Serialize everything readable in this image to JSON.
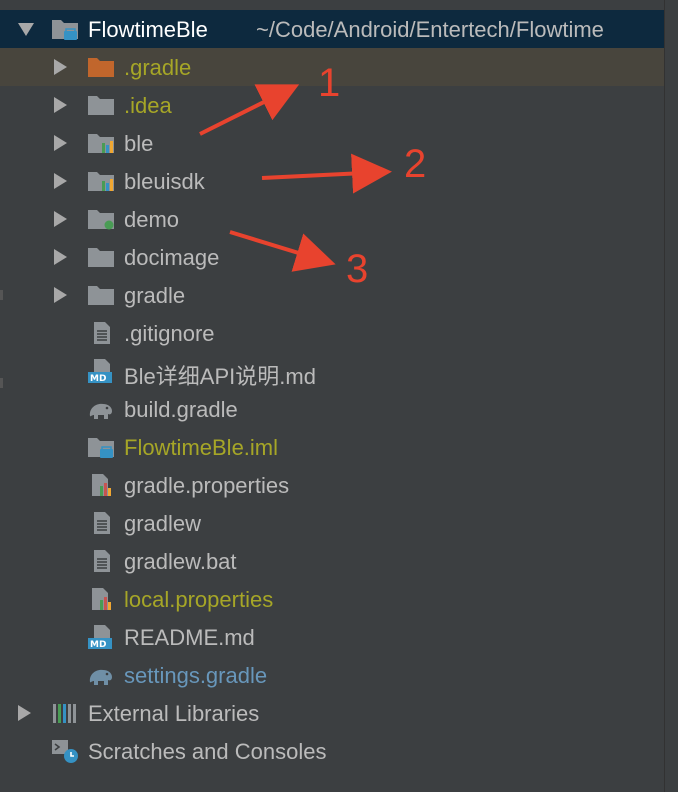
{
  "tree": {
    "root": {
      "name": "FlowtimeBle",
      "path": "~/Code/Android/Entertech/Flowtime",
      "icon": "folder-module-icon",
      "expanded": true
    },
    "items": [
      {
        "label": ".gradle",
        "icon": "folder-icon",
        "expandable": true,
        "color": "olive"
      },
      {
        "label": ".idea",
        "icon": "folder-icon",
        "expandable": true,
        "color": "olive"
      },
      {
        "label": "ble",
        "icon": "library-module-icon",
        "expandable": true,
        "color": "default"
      },
      {
        "label": "bleuisdk",
        "icon": "library-module-icon",
        "expandable": true,
        "color": "default"
      },
      {
        "label": "demo",
        "icon": "app-module-icon",
        "expandable": true,
        "color": "default"
      },
      {
        "label": "docimage",
        "icon": "folder-icon",
        "expandable": true,
        "color": "default"
      },
      {
        "label": "gradle",
        "icon": "folder-icon",
        "expandable": true,
        "color": "default"
      },
      {
        "label": ".gitignore",
        "icon": "text-file-icon",
        "expandable": false,
        "color": "default"
      },
      {
        "label": "Ble详细API说明.md",
        "icon": "markdown-file-icon",
        "expandable": false,
        "color": "default"
      },
      {
        "label": "build.gradle",
        "icon": "gradle-elephant-icon",
        "expandable": false,
        "color": "default"
      },
      {
        "label": "FlowtimeBle.iml",
        "icon": "iml-file-icon",
        "expandable": false,
        "color": "olive"
      },
      {
        "label": "gradle.properties",
        "icon": "properties-file-icon",
        "expandable": false,
        "color": "default"
      },
      {
        "label": "gradlew",
        "icon": "text-file-icon",
        "expandable": false,
        "color": "default"
      },
      {
        "label": "gradlew.bat",
        "icon": "text-file-icon",
        "expandable": false,
        "color": "default"
      },
      {
        "label": "local.properties",
        "icon": "properties-file-icon",
        "expandable": false,
        "color": "olive"
      },
      {
        "label": "README.md",
        "icon": "markdown-file-icon",
        "expandable": false,
        "color": "default"
      },
      {
        "label": "settings.gradle",
        "icon": "gradle-elephant-icon",
        "expandable": false,
        "color": "blue"
      }
    ],
    "footer": [
      {
        "label": "External Libraries",
        "icon": "external-libraries-icon",
        "expandable": true
      },
      {
        "label": "Scratches and Consoles",
        "icon": "scratches-icon",
        "expandable": false
      }
    ]
  },
  "annotations": [
    {
      "number": "1",
      "points_to": "ble"
    },
    {
      "number": "2",
      "points_to": "bleuisdk"
    },
    {
      "number": "3",
      "points_to": "demo"
    }
  ],
  "colors": {
    "background": "#3c3f41",
    "selected_row": "#0d293e",
    "highlight_row": "#48453d",
    "default_text": "#bbbbbb",
    "olive_text": "#a6a627",
    "blue_text": "#6897bb",
    "annotation": "#e8432e"
  }
}
